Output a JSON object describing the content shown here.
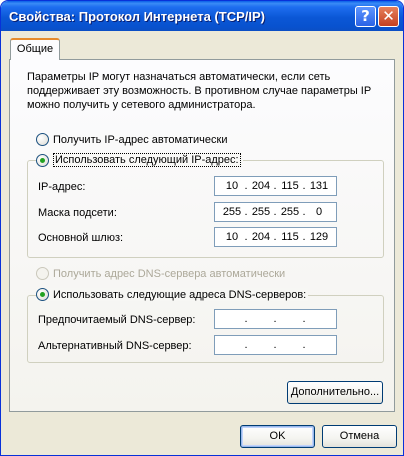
{
  "window": {
    "title": "Свойства: Протокол Интернета (TCP/IP)",
    "help_glyph": "?",
    "close_glyph": "✕"
  },
  "tabs": [
    {
      "label": "Общие",
      "active": true
    }
  ],
  "intro_text": "Параметры IP могут назначаться автоматически, если сеть поддерживает эту возможность. В противном случае параметры IP можно получить у сетевого администратора.",
  "ip": {
    "auto_option": "Получить IP-адрес автоматически",
    "manual_option": "Использовать следующий IP-адрес:",
    "selected": "manual",
    "fields": [
      {
        "label": "IP-адрес:",
        "octets": [
          "10",
          "204",
          "115",
          "131"
        ]
      },
      {
        "label": "Маска подсети:",
        "octets": [
          "255",
          "255",
          "255",
          "0"
        ]
      },
      {
        "label": "Основной шлюз:",
        "octets": [
          "10",
          "204",
          "115",
          "129"
        ]
      }
    ]
  },
  "dns": {
    "auto_option": "Получить адрес DNS-сервера автоматически",
    "auto_disabled": true,
    "manual_option": "Использовать следующие адреса DNS-серверов:",
    "selected": "manual",
    "fields": [
      {
        "label": "Предпочитаемый DNS-сервер:",
        "octets": [
          "",
          "",
          "",
          ""
        ]
      },
      {
        "label": "Альтернативный DNS-сервер:",
        "octets": [
          "",
          "",
          "",
          ""
        ]
      }
    ]
  },
  "buttons": {
    "advanced": "Дополнительно...",
    "ok": "OK",
    "cancel": "Отмена"
  },
  "colors": {
    "titlebar": "#0b57d6",
    "dialog_bg": "#ece9d8",
    "tab_accent": "#e68b2c",
    "radio_dot": "#21a121",
    "input_border": "#7f9db9",
    "disabled_text": "#aca899"
  }
}
